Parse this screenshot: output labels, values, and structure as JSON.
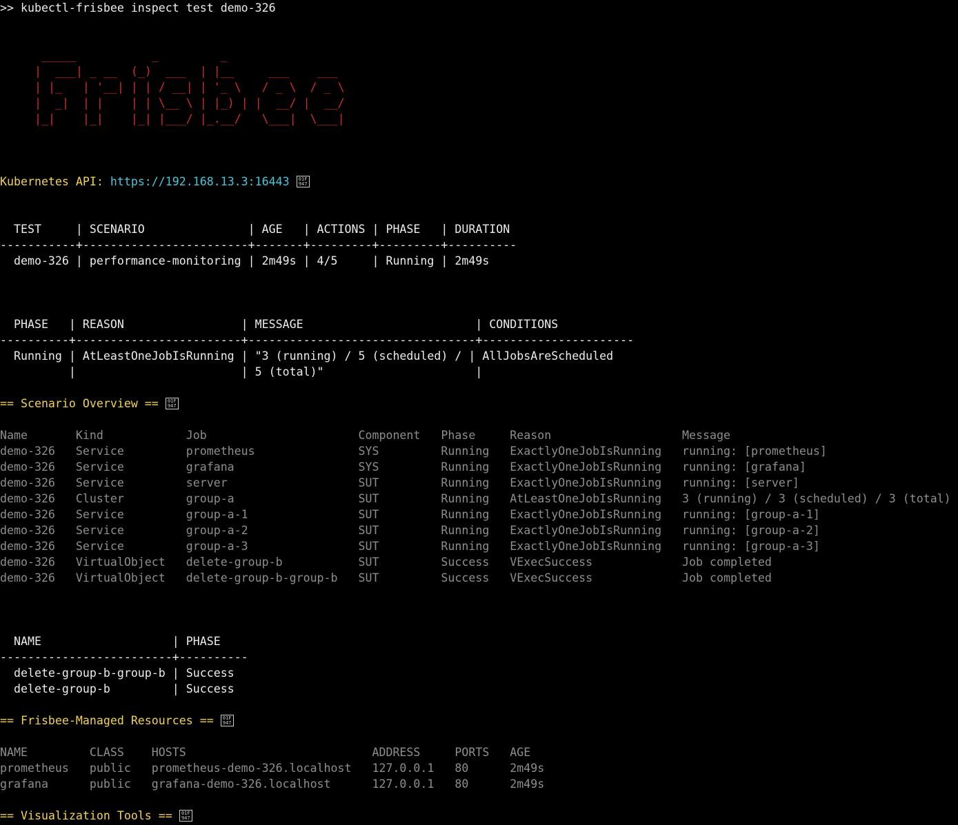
{
  "command": ">> kubectl-frisbee inspect test demo-326",
  "banner": " _____           _         _\n|  ___| _ __  (_)  ___  | |__     ___    ___\n| |_   | '__| | | / __| | '_ \\   / _ \\  / _ \\\n|  _|  | |    | | \\__ \\ | |_) | |  __/ |  __/\n|_|    |_|    |_| |___/ |_.__/   \\___|  \\___|",
  "api": {
    "label": "Kubernetes API:",
    "url": "https://192.168.13.3:16443",
    "glyph": "01F\n947"
  },
  "test_table": {
    "header": "  TEST     | SCENARIO               | AGE   | ACTIONS | PHASE   | DURATION",
    "rule": "-----------+------------------------+-------+---------+---------+----------",
    "row": "  demo-326 | performance-monitoring | 2m49s | 4/5     | Running | 2m49s"
  },
  "phase_table": {
    "header": "  PHASE   | REASON                 | MESSAGE                         | CONDITIONS",
    "rule": "----------+------------------------+---------------------------------+----------------------",
    "row1": "  Running | AtLeastOneJobIsRunning | \"3 (running) / 5 (scheduled) / | AllJobsAreScheduled",
    "row2": "          |                        | 5 (total)\"                      |"
  },
  "scenario": {
    "heading": "== Scenario Overview ==",
    "columns": "Name       Kind            Job                      Component   Phase     Reason                   Message",
    "rows": [
      "demo-326   Service         prometheus               SYS         Running   ExactlyOneJobIsRunning   running: [prometheus]",
      "demo-326   Service         grafana                  SYS         Running   ExactlyOneJobIsRunning   running: [grafana]",
      "demo-326   Service         server                   SUT         Running   ExactlyOneJobIsRunning   running: [server]",
      "demo-326   Cluster         group-a                  SUT         Running   AtLeastOneJobIsRunning   3 (running) / 3 (scheduled) / 3 (total)",
      "demo-326   Service         group-a-1                SUT         Running   ExactlyOneJobIsRunning   running: [group-a-1]",
      "demo-326   Service         group-a-2                SUT         Running   ExactlyOneJobIsRunning   running: [group-a-2]",
      "demo-326   Service         group-a-3                SUT         Running   ExactlyOneJobIsRunning   running: [group-a-3]",
      "demo-326   VirtualObject   delete-group-b           SUT         Success   VExecSuccess             Job completed",
      "demo-326   VirtualObject   delete-group-b-group-b   SUT         Success   VExecSuccess             Job completed"
    ]
  },
  "virtual_table": {
    "header": "  NAME                   | PHASE",
    "rule": "-------------------------+----------",
    "rows": [
      "  delete-group-b-group-b | Success",
      "  delete-group-b         | Success"
    ]
  },
  "resources": {
    "heading": "== Frisbee-Managed Resources ==",
    "columns": "NAME         CLASS    HOSTS                           ADDRESS     PORTS   AGE",
    "rows": [
      "prometheus   public   prometheus-demo-326.localhost   127.0.0.1   80      2m49s",
      "grafana      public   grafana-demo-326.localhost      127.0.0.1   80      2m49s"
    ]
  },
  "visualization": {
    "heading": "== Visualization Tools =="
  }
}
